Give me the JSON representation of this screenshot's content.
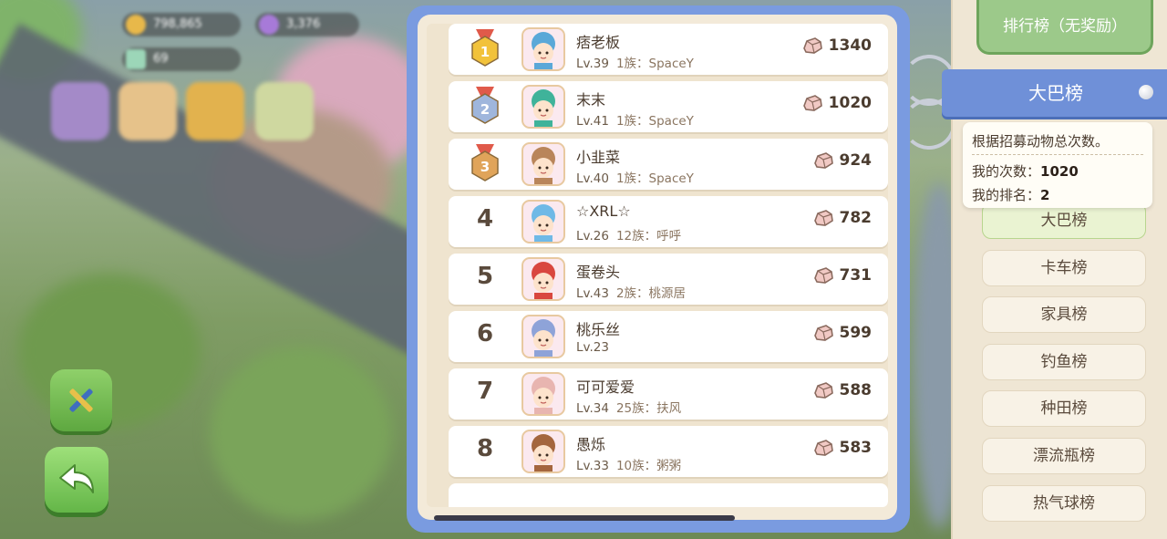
{
  "hud": {
    "coins": "798,865",
    "gems": "3,376",
    "level_counter": "69"
  },
  "panel": {
    "rows": [
      {
        "rank": "1",
        "medal": "gold",
        "name": "痞老板",
        "level": "Lv.39",
        "clan": "1族：SpaceY",
        "score": "1340",
        "avatar_color": "#5aa8d8"
      },
      {
        "rank": "2",
        "medal": "silver",
        "name": "末末",
        "level": "Lv.41",
        "clan": "1族：SpaceY",
        "score": "1020",
        "avatar_color": "#3fb39a"
      },
      {
        "rank": "3",
        "medal": "bronze",
        "name": "小韭菜",
        "level": "Lv.40",
        "clan": "1族：SpaceY",
        "score": "924",
        "avatar_color": "#b9855a"
      },
      {
        "rank": "4",
        "medal": "",
        "name": "☆XRL☆",
        "level": "Lv.26",
        "clan": "12族：呼呼",
        "score": "782",
        "avatar_color": "#6fb9e6"
      },
      {
        "rank": "5",
        "medal": "",
        "name": "蛋卷头",
        "level": "Lv.43",
        "clan": "2族：桃源居",
        "score": "731",
        "avatar_color": "#d9473f"
      },
      {
        "rank": "6",
        "medal": "",
        "name": "桃乐丝",
        "level": "Lv.23",
        "clan": "",
        "score": "599",
        "avatar_color": "#8ea3d8"
      },
      {
        "rank": "7",
        "medal": "",
        "name": "可可爱爱",
        "level": "Lv.34",
        "clan": "25族：扶风",
        "score": "588",
        "avatar_color": "#e8b5b0"
      },
      {
        "rank": "8",
        "medal": "",
        "name": "愚烁",
        "level": "Lv.33",
        "clan": "10族：粥粥",
        "score": "583",
        "avatar_color": "#a4663e"
      }
    ]
  },
  "sidebar": {
    "title": "排行榜（无奖励）",
    "banner": "大巴榜",
    "info": {
      "description": "根据招募动物总次数。",
      "my_count_label": "我的次数：",
      "my_count": "1020",
      "my_rank_label": "我的排名：",
      "my_rank": "2"
    },
    "tabs": [
      {
        "label": "大巴榜",
        "active": true
      },
      {
        "label": "卡车榜",
        "active": false
      },
      {
        "label": "家具榜",
        "active": false
      },
      {
        "label": "钓鱼榜",
        "active": false
      },
      {
        "label": "种田榜",
        "active": false
      },
      {
        "label": "漂流瓶榜",
        "active": false
      },
      {
        "label": "热气球榜",
        "active": false
      }
    ]
  },
  "colors": {
    "panel_frame": "#7a9be0",
    "banner": "#6f90d8",
    "title_green": "#9cc98a",
    "gold": "#f2c23a",
    "silver": "#9fb6dc",
    "bronze": "#e0a45a"
  }
}
